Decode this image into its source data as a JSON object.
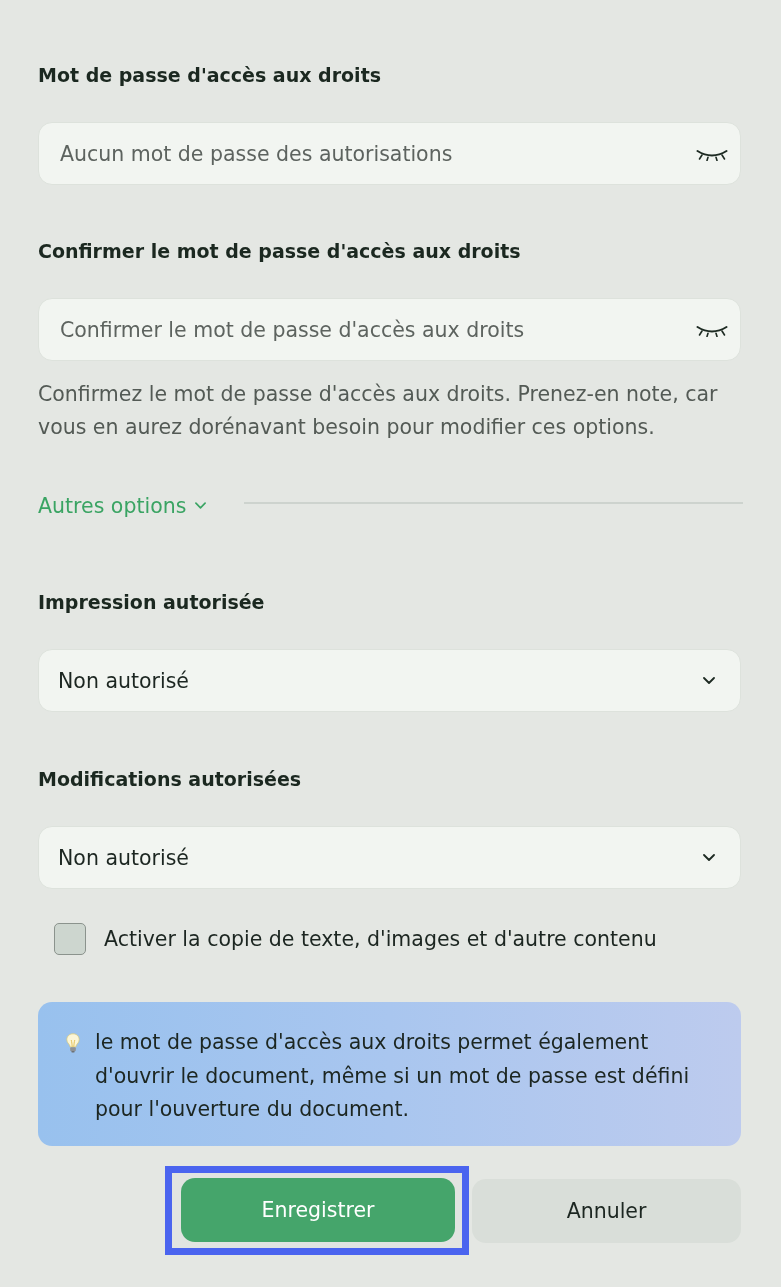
{
  "password_fields": [
    {
      "label": "Mot de passe d'accès aux droits",
      "placeholder": "Aucun mot de passe des autorisations"
    },
    {
      "label": "Confirmer le mot de passe d'accès aux droits",
      "placeholder": "Confirmer le mot de passe d'accès aux droits",
      "hint": "Confirmez le mot de passe d'accès aux droits. Prenez-en note, car vous en aurez dorénavant besoin pour modifier ces options."
    }
  ],
  "more_options": {
    "label": "Autres options"
  },
  "selects": [
    {
      "label": "Impression autorisée",
      "value": "Non autorisé"
    },
    {
      "label": "Modifications autorisées",
      "value": "Non autorisé"
    }
  ],
  "checkbox": {
    "label": "Activer la copie de texte, d'images et d'autre contenu",
    "checked": false
  },
  "info": {
    "text": "le mot de passe d'accès aux droits permet également d'ouvrir le document, même si un mot de passe est défini pour l'ouverture du document."
  },
  "buttons": [
    {
      "label": "Enregistrer",
      "kind": "primary",
      "highlighted": true
    },
    {
      "label": "Annuler",
      "kind": "secondary",
      "highlighted": false
    }
  ]
}
